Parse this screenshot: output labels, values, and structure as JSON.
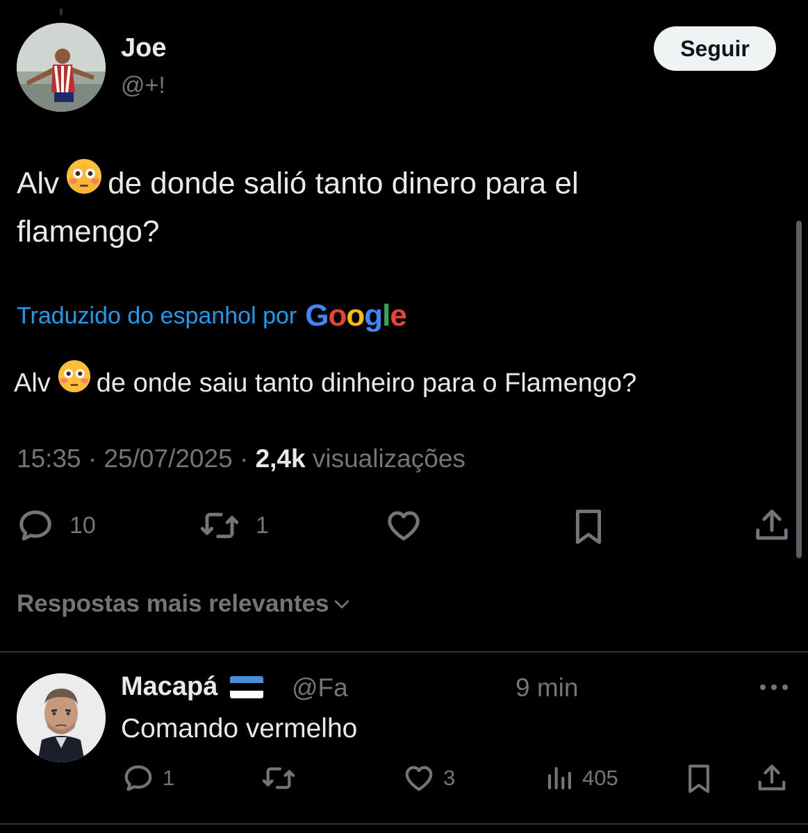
{
  "tweet": {
    "author": {
      "name": "Joe",
      "handle": "@+!"
    },
    "follow_label": "Seguir",
    "text_before_emoji": "Alv",
    "text_after_emoji": "de donde salió tanto dinero para el flamengo?",
    "translation": {
      "label": "Traduzido do espanhol por",
      "provider_letters": [
        "G",
        "o",
        "o",
        "g",
        "l",
        "e"
      ],
      "text_before_emoji": "Alv",
      "text_after_emoji": "de onde saiu tanto dinheiro para o Flamengo?"
    },
    "meta": {
      "time": "15:35",
      "separator": "·",
      "date": "25/07/2025",
      "views_count": "2,4k",
      "views_label": "visualizações"
    },
    "actions": {
      "replies": "10",
      "retweets": "1"
    }
  },
  "replies_sort_label": "Respostas mais relevantes",
  "reply": {
    "author": {
      "name": "Macapá",
      "handle": "@Fa",
      "time": "9 min"
    },
    "text": "Comando vermelho",
    "actions": {
      "replies": "1",
      "likes": "3",
      "views": "405"
    }
  },
  "colors": {
    "background": "#000000",
    "text_primary": "#e7e9ea",
    "text_secondary": "#71767b",
    "link": "#1d9bf0",
    "follow_button_bg": "#eff3f4"
  },
  "icons": [
    "reply-icon",
    "retweet-icon",
    "like-icon",
    "bookmark-icon",
    "share-icon",
    "views-icon",
    "more-icon",
    "chevron-down-icon",
    "flushed-face-emoji",
    "estonia-flag"
  ]
}
